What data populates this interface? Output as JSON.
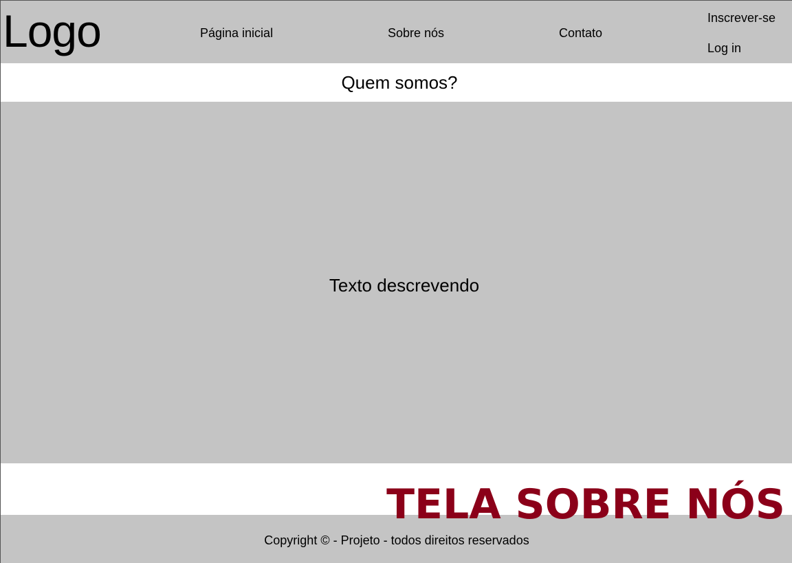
{
  "header": {
    "logo": "Logo",
    "nav": {
      "home": "Página inicial",
      "about": "Sobre nós",
      "contact": "Contato"
    },
    "auth": {
      "signup": "Inscrever-se",
      "login": "Log in"
    }
  },
  "main": {
    "heading": "Quem somos?",
    "body_text": "Texto descrevendo"
  },
  "footer": {
    "copyright": "Copyright © - Projeto - todos direitos reservados"
  },
  "overlay": {
    "screen_label": "TELA SOBRE NÓS"
  },
  "colors": {
    "panel_gray": "#c4c4c4",
    "label_red": "#8b0019",
    "background": "#ffffff"
  }
}
